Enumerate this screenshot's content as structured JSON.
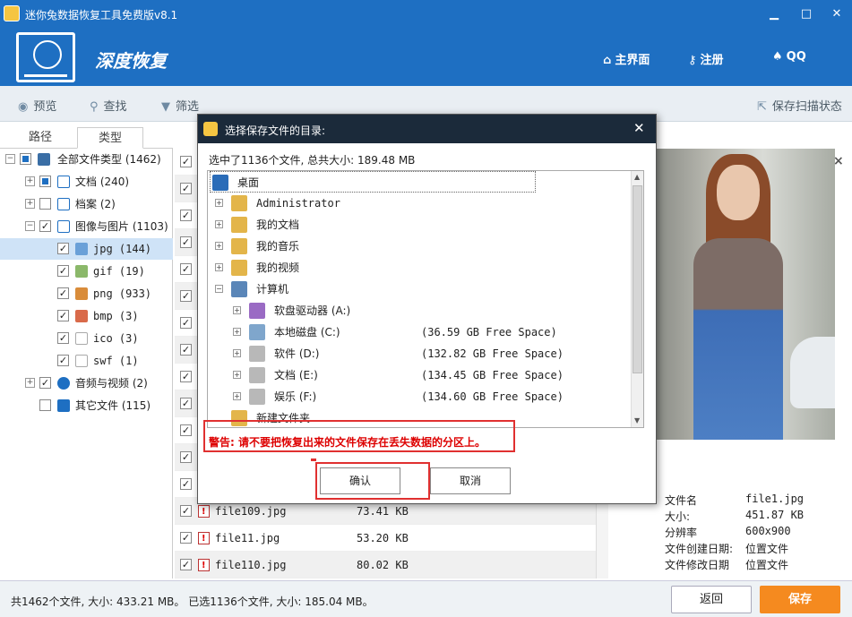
{
  "titlebar": {
    "title": "迷你兔数据恢复工具免费版v8.1",
    "minimize": "▁",
    "maximize": "□",
    "close": "✕"
  },
  "header": {
    "brand": "深度恢复",
    "home": "主界面",
    "register": "注册",
    "qq": "QQ"
  },
  "toolbar": {
    "preview": "预览",
    "find": "查找",
    "filter": "筛选",
    "save_scan": "保存扫描状态"
  },
  "tabs": {
    "path": "路径",
    "type": "类型"
  },
  "tree": {
    "root": "全部文件类型 (1462)",
    "doc": "文档 (240)",
    "archive": "档案 (2)",
    "images": "图像与图片 (1103)",
    "jpg": "jpg (144)",
    "gif": "gif (19)",
    "png": "png (933)",
    "bmp": "bmp (3)",
    "ico": "ico (3)",
    "swf": "swf (1)",
    "av": "音频与视频 (2)",
    "other": "其它文件 (115)"
  },
  "files": [
    {
      "name": "file109.jpg",
      "size": "73.41 KB"
    },
    {
      "name": "file11.jpg",
      "size": "53.20 KB"
    },
    {
      "name": "file110.jpg",
      "size": "80.02 KB"
    }
  ],
  "preview": {
    "close": "×",
    "props": [
      {
        "k": "文件名",
        "v": "file1.jpg"
      },
      {
        "k": "大小:",
        "v": "451.87 KB"
      },
      {
        "k": "分辨率",
        "v": "600x900"
      },
      {
        "k": "文件创建日期:",
        "v": "位置文件"
      },
      {
        "k": "文件修改日期",
        "v": "位置文件"
      }
    ]
  },
  "status": {
    "text": "共1462个文件, 大小: 433.21 MB。 已选1136个文件, 大小: 185.04 MB。",
    "back": "返回",
    "save": "保存"
  },
  "dialog": {
    "title": "选择保存文件的目录:",
    "close": "✕",
    "selected": "选中了1136个文件, 总共大小: 189.48 MB",
    "tree": {
      "desktop": "桌面",
      "admin": "Administrator",
      "mydocs": "我的文档",
      "mymusic": "我的音乐",
      "myvideo": "我的视频",
      "computer": "计算机",
      "floppy": "软盘驱动器 (A:)",
      "local": "本地磁盘 (C:)",
      "local_free": "(36.59 GB Free Space)",
      "soft": "软件 (D:)",
      "soft_free": "(132.82 GB Free Space)",
      "docs": "文档 (E:)",
      "docs_free": "(134.45 GB Free Space)",
      "ent": "娱乐 (F:)",
      "ent_free": "(134.60 GB Free Space)",
      "newfolder": "新建文件夹"
    },
    "warning": "警告: 请不要把恢复出来的文件保存在丢失数据的分区上。",
    "ok": "确认",
    "cancel": "取消"
  },
  "colors": {
    "accent": "#1e6fc2",
    "save": "#f58a1f",
    "warning": "#e03030",
    "dialog_title": "#1b2a3a"
  }
}
